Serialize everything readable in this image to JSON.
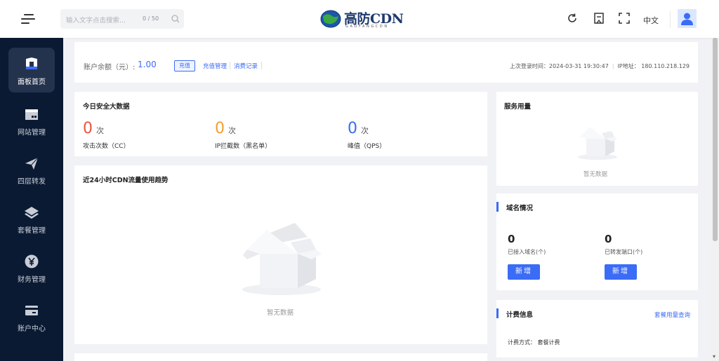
{
  "header": {
    "search_placeholder": "输入文字点击搜索...",
    "search_count": "0 / 50",
    "logo_name": "高防CDN",
    "logo_sub": "GAOFANGCDN",
    "language": "中文"
  },
  "sidebar": {
    "items": [
      {
        "label": "面板首页",
        "icon": "dashboard-icon"
      },
      {
        "label": "网站管理",
        "icon": "website-icon"
      },
      {
        "label": "四层转发",
        "icon": "paper-plane-icon"
      },
      {
        "label": "套餐管理",
        "icon": "layers-icon"
      },
      {
        "label": "财务管理",
        "icon": "yuan-icon"
      },
      {
        "label": "账户中心",
        "icon": "card-icon"
      }
    ]
  },
  "account": {
    "balance_label": "账户余额（元）:",
    "balance_value": "1.00",
    "recharge": "充值",
    "recharge_manage": "充值管理",
    "consume_record": "消费记录",
    "last_login": "上次登录时间：2024-03-31 19:30:47",
    "ip": "IP地址： 180.110.218.129"
  },
  "security": {
    "title": "今日安全大数据",
    "stats": [
      {
        "value": "0",
        "unit": "次",
        "label": "攻击次数（CC）",
        "color": "#e8553f"
      },
      {
        "value": "0",
        "unit": "次",
        "label": "IP拦截数（黑名单）",
        "color": "#f0a030"
      },
      {
        "value": "0",
        "unit": "次",
        "label": "峰值（QPS）",
        "color": "#3b6cf6"
      }
    ]
  },
  "traffic": {
    "title": "近24小时CDN流量使用趋势",
    "empty": "暂无数据"
  },
  "service": {
    "title": "服务用量",
    "empty": "暂无数据"
  },
  "domain": {
    "title": "域名情况",
    "connected_value": "0",
    "connected_label": "已接入域名(个)",
    "ports_value": "0",
    "ports_label": "已转发端口(个)",
    "add_label": "新增"
  },
  "billing": {
    "title": "计费信息",
    "query_link": "套餐用量查询",
    "method": "计费方式： 套餐计费"
  }
}
